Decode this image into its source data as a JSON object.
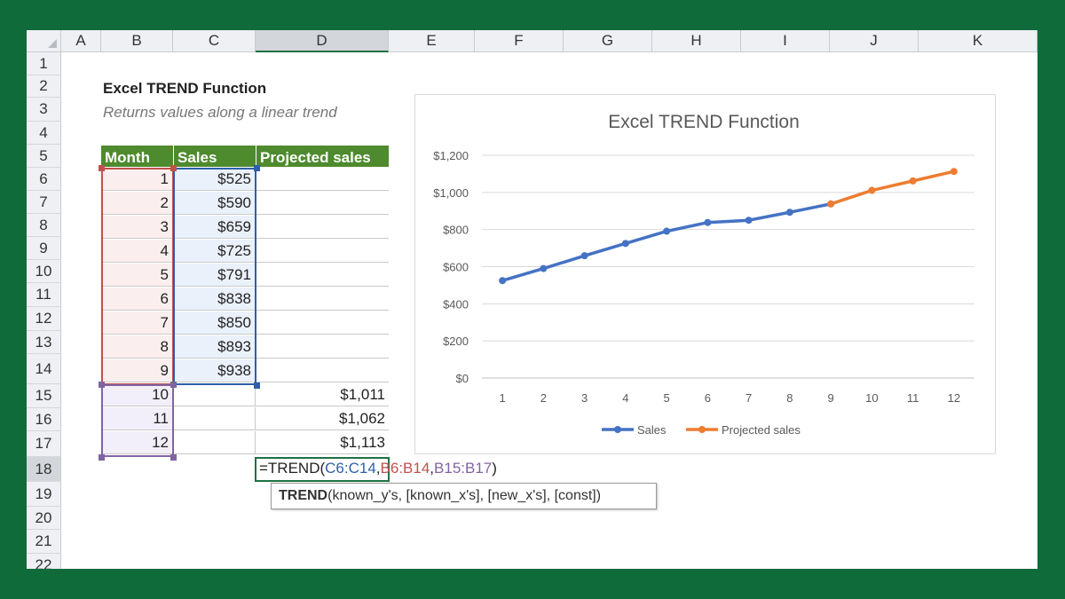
{
  "columns": [
    "A",
    "B",
    "C",
    "D",
    "E",
    "F",
    "G",
    "H",
    "I",
    "J",
    "K"
  ],
  "rows": [
    "1",
    "2",
    "3",
    "4",
    "5",
    "6",
    "7",
    "8",
    "9",
    "10",
    "11",
    "12",
    "13",
    "14",
    "15",
    "16",
    "17",
    "18",
    "19",
    "20",
    "21",
    "22"
  ],
  "sheet_title": "Excel TREND Function",
  "sheet_subtitle": "Returns values along a linear trend",
  "table": {
    "headers": [
      "Month",
      "Sales",
      "Projected sales"
    ],
    "rows": [
      {
        "month": "1",
        "sales": "$525",
        "projected": ""
      },
      {
        "month": "2",
        "sales": "$590",
        "projected": ""
      },
      {
        "month": "3",
        "sales": "$659",
        "projected": ""
      },
      {
        "month": "4",
        "sales": "$725",
        "projected": ""
      },
      {
        "month": "5",
        "sales": "$791",
        "projected": ""
      },
      {
        "month": "6",
        "sales": "$838",
        "projected": ""
      },
      {
        "month": "7",
        "sales": "$850",
        "projected": ""
      },
      {
        "month": "8",
        "sales": "$893",
        "projected": ""
      },
      {
        "month": "9",
        "sales": "$938",
        "projected": ""
      },
      {
        "month": "10",
        "sales": "",
        "projected": "$1,011"
      },
      {
        "month": "11",
        "sales": "",
        "projected": "$1,062"
      },
      {
        "month": "12",
        "sales": "",
        "projected": "$1,113"
      }
    ]
  },
  "formula": {
    "prefix": "=TREND(",
    "arg1": "C6:C14",
    "sep1": ",",
    "arg2": "B6:B14",
    "sep2": ",",
    "arg3": "B15:B17",
    "suffix": ")"
  },
  "tooltip": {
    "func": "TREND",
    "args": "(known_y's, [known_x's], [new_x's], [const])"
  },
  "colors": {
    "header_green": "#4e8a2e",
    "range_red": "#c0504d",
    "range_blue": "#2e5fa8",
    "range_purple": "#8064a2",
    "sales_line": "#4472c4",
    "projected_line": "#ed7d31"
  },
  "chart_data": {
    "type": "line",
    "title": "Excel TREND Function",
    "x": [
      1,
      2,
      3,
      4,
      5,
      6,
      7,
      8,
      9,
      10,
      11,
      12
    ],
    "yticks": [
      "$0",
      "$200",
      "$400",
      "$600",
      "$800",
      "$1,000",
      "$1,200"
    ],
    "ylim": [
      0,
      1200
    ],
    "grid": true,
    "legend_position": "bottom",
    "series": [
      {
        "name": "Sales",
        "x": [
          1,
          2,
          3,
          4,
          5,
          6,
          7,
          8,
          9
        ],
        "values": [
          525,
          590,
          659,
          725,
          791,
          838,
          850,
          893,
          938
        ]
      },
      {
        "name": "Projected sales",
        "x": [
          9,
          10,
          11,
          12
        ],
        "values": [
          938,
          1011,
          1062,
          1113
        ]
      }
    ]
  }
}
